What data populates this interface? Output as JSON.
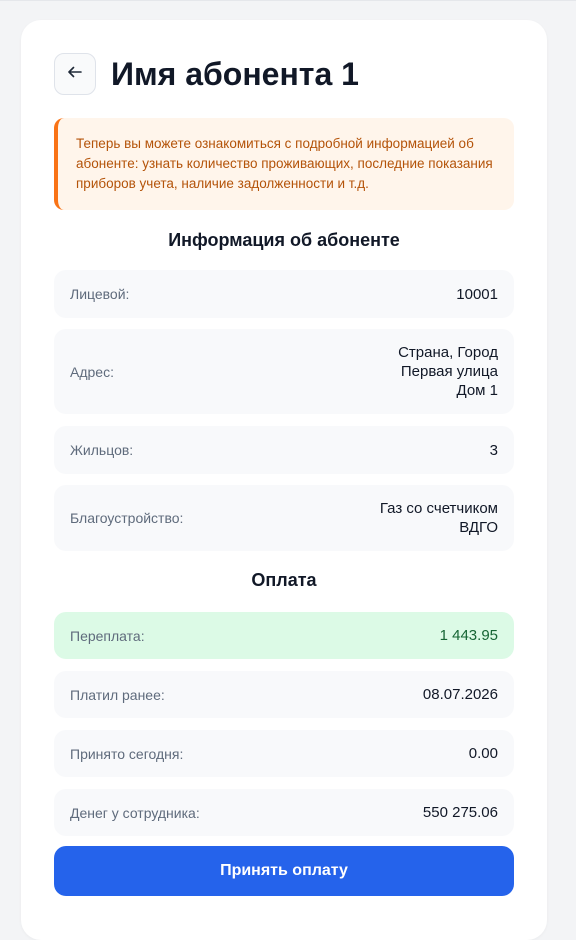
{
  "header": {
    "title": "Имя абонента 1"
  },
  "notice": {
    "text": "Теперь вы можете ознакомиться с подробной информацией об абоненте: узнать количество проживающих, последние показания приборов учета, наличие задолженности и т.д."
  },
  "info": {
    "title": "Информация об абоненте",
    "account": {
      "label": "Лицевой:",
      "value": "10001"
    },
    "address": {
      "label": "Адрес:",
      "lines": [
        "Страна, Город",
        "Первая улица",
        "Дом 1"
      ]
    },
    "residents": {
      "label": "Жильцов:",
      "value": "3"
    },
    "amenities": {
      "label": "Благоустройство:",
      "lines": [
        "Газ со счетчиком",
        "ВДГО"
      ]
    }
  },
  "payment": {
    "title": "Оплата",
    "overpayment": {
      "label": "Переплата:",
      "value": "1 443.95"
    },
    "paid_before": {
      "label": "Платил ранее:",
      "value": "08.07.2026"
    },
    "accepted_today": {
      "label": "Принято сегодня:",
      "value": "0.00"
    },
    "employee_money": {
      "label": "Денег у сотрудника:",
      "value": "550 275.06"
    },
    "button_label": "Принять оплату"
  },
  "colors": {
    "accent": "#2563eb",
    "notice_border": "#f97316",
    "notice_bg": "#fff5eb",
    "overpayment_bg": "#dcfae6"
  }
}
